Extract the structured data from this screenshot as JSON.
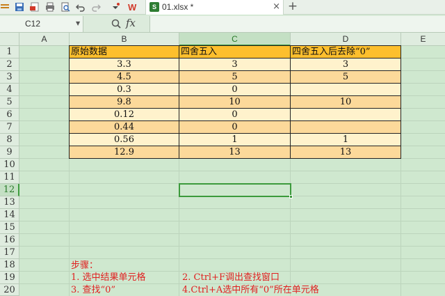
{
  "tab": {
    "filename": "01.xlsx *",
    "close": "×",
    "new_tab": "+"
  },
  "toolbar": {
    "wps_logo": "W"
  },
  "formula_bar": {
    "cell_ref": "C12",
    "fx": "fx",
    "content": ""
  },
  "columns": [
    "A",
    "B",
    "C",
    "D",
    "E"
  ],
  "rows": [
    "1",
    "2",
    "3",
    "4",
    "5",
    "6",
    "7",
    "8",
    "9",
    "10",
    "11",
    "12",
    "13",
    "14",
    "15",
    "16",
    "17",
    "18",
    "19",
    "20"
  ],
  "table": {
    "headers": [
      "原始数据",
      "四舍五入",
      "四舍五入后去除“0”"
    ],
    "data": [
      [
        "3.3",
        "3",
        "3"
      ],
      [
        "4.5",
        "5",
        "5"
      ],
      [
        "0.3",
        "0",
        ""
      ],
      [
        "9.8",
        "10",
        "10"
      ],
      [
        "0.12",
        "0",
        ""
      ],
      [
        "0.44",
        "0",
        ""
      ],
      [
        "0.56",
        "1",
        "1"
      ],
      [
        "12.9",
        "13",
        "13"
      ]
    ]
  },
  "notes": {
    "title": "步骤：",
    "step1": "1.  选中结果单元格",
    "step2": "2.  Ctrl+F调出查找窗口",
    "step3": "3.  查找“0”",
    "step4": "4.Ctrl+A选中所有“0”所在单元格"
  },
  "colors": {
    "header_fill": "#fdbf2d",
    "dark_fill": "#fcd99a",
    "light_fill": "#fff2cc",
    "note_text": "#e02020",
    "selection": "#3c9a3c"
  }
}
